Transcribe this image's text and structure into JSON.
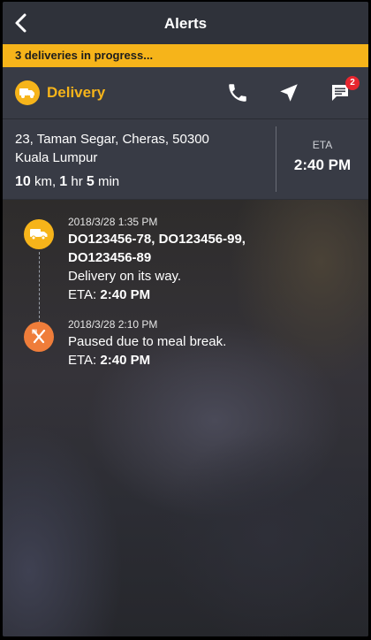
{
  "header": {
    "title": "Alerts"
  },
  "banner": {
    "text": "3 deliveries in progress..."
  },
  "delivery": {
    "label": "Delivery",
    "chat_badge": "2",
    "address_line1": "23, Taman Segar, Cheras,  50300",
    "address_line2": "Kuala Lumpur",
    "distance_value": "10",
    "distance_unit": " km, ",
    "hours_value": "1",
    "hours_unit": " hr ",
    "minutes_value": "5",
    "minutes_unit": " min",
    "eta_label": "ETA",
    "eta_time": "2:40 PM"
  },
  "timeline": [
    {
      "icon": "truck-icon",
      "timestamp": "2018/3/28 1:35 PM",
      "ids_line1": "DO123456-78, DO123456-99,",
      "ids_line2": "DO123456-89",
      "message": "Delivery on its way.",
      "eta_prefix": "ETA: ",
      "eta_value": "2:40 PM"
    },
    {
      "icon": "utensils-icon",
      "timestamp": "2018/3/28 2:10 PM",
      "message": "Paused due to meal break.",
      "eta_prefix": "ETA: ",
      "eta_value": "2:40 PM"
    }
  ],
  "colors": {
    "accent": "#f6b41a",
    "truck_dot": "#f6b41a",
    "meal_dot": "#ef7d3a",
    "badge": "#e8262f"
  }
}
